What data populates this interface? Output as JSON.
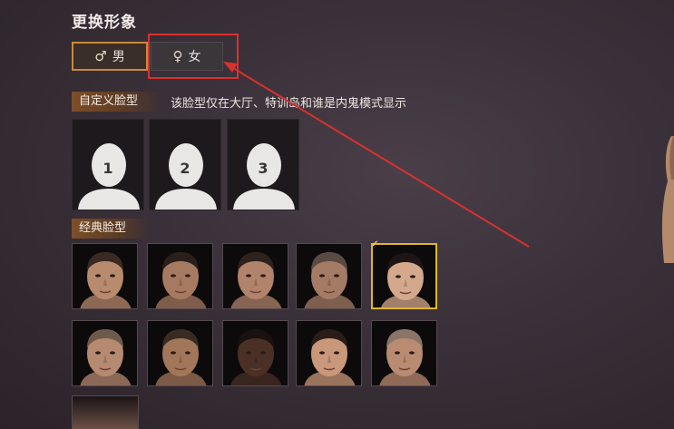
{
  "title": "更换形象",
  "gender": {
    "male": {
      "symbol": "♂",
      "label": "男"
    },
    "female": {
      "symbol": "♀",
      "label": "女"
    }
  },
  "custom": {
    "header": "自定义脸型",
    "note": "该脸型仅在大厅、特训岛和谁是内鬼模式显示",
    "slots": [
      "1",
      "2",
      "3"
    ]
  },
  "classic": {
    "header": "经典脸型",
    "selected_index": 4,
    "faces": [
      {
        "name": "face-1",
        "skin": "#b88a6e",
        "hair": "#3b2a22"
      },
      {
        "name": "face-2",
        "skin": "#a57a60",
        "hair": "#2a1f1a"
      },
      {
        "name": "face-3",
        "skin": "#b0836a",
        "hair": "#2e221c"
      },
      {
        "name": "face-4",
        "skin": "#a47b64",
        "hair": "#5a4a44"
      },
      {
        "name": "face-5",
        "skin": "#d4a88c",
        "hair": "#1e1614"
      },
      {
        "name": "face-6",
        "skin": "#b58a70",
        "hair": "#6e5a4c"
      },
      {
        "name": "face-7",
        "skin": "#a27659",
        "hair": "#3a2b22"
      },
      {
        "name": "face-8",
        "skin": "#4a3025",
        "hair": "#1a1210"
      },
      {
        "name": "face-9",
        "skin": "#c9977a",
        "hair": "#2a1d18"
      },
      {
        "name": "face-10",
        "skin": "#b98b72",
        "hair": "#8a7468"
      }
    ]
  },
  "colors": {
    "accent": "#c98a3b",
    "selected": "#e1b52b",
    "annotation": "#d8312e"
  }
}
